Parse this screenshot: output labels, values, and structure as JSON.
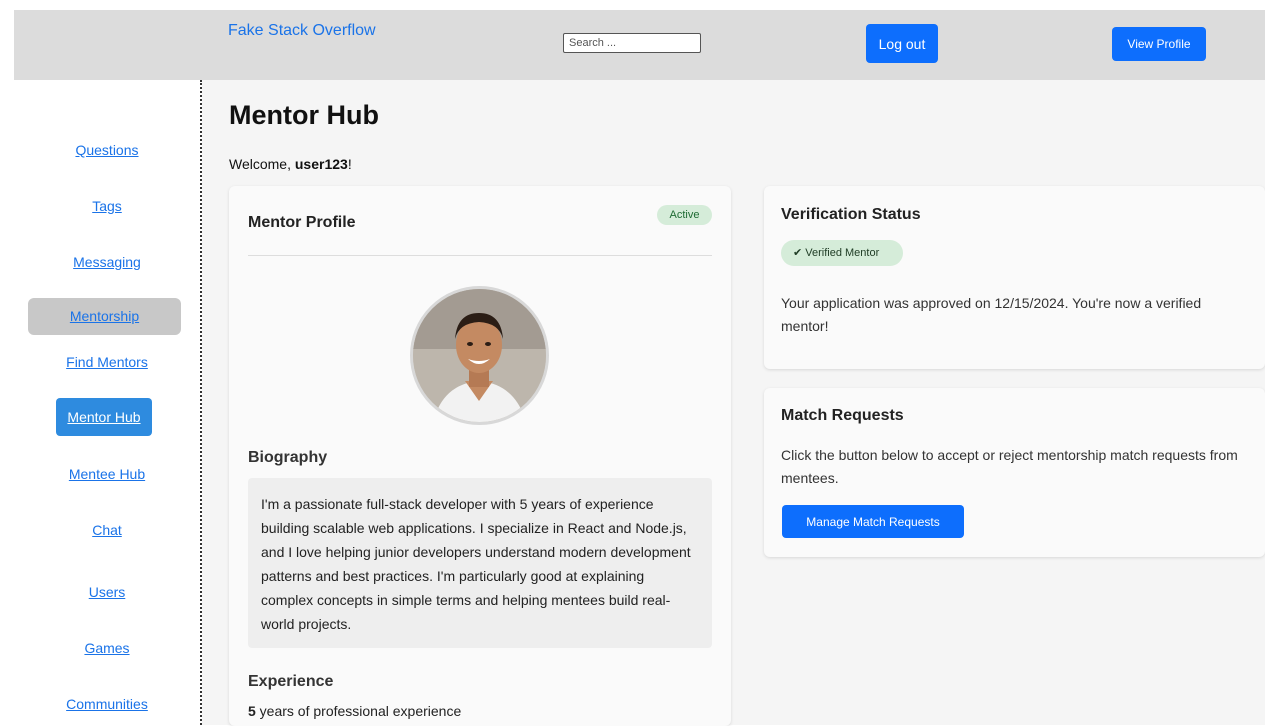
{
  "header": {
    "brand": "Fake Stack Overflow",
    "search_placeholder": "Search ...",
    "logout_label": "Log out",
    "view_profile_label": "View Profile"
  },
  "sidebar": {
    "items": [
      {
        "label": "Questions"
      },
      {
        "label": "Tags"
      },
      {
        "label": "Messaging"
      },
      {
        "label": "Mentorship"
      },
      {
        "label": "Find Mentors"
      },
      {
        "label": "Mentor Hub"
      },
      {
        "label": "Mentee Hub"
      },
      {
        "label": "Chat"
      },
      {
        "label": "Users"
      },
      {
        "label": "Games"
      },
      {
        "label": "Communities"
      }
    ]
  },
  "main": {
    "title": "Mentor Hub",
    "welcome_prefix": "Welcome, ",
    "username": "user123",
    "welcome_suffix": "!"
  },
  "profile": {
    "title": "Mentor Profile",
    "status": "Active",
    "biography_heading": "Biography",
    "biography": "I'm a passionate full-stack developer with 5 years of experience building scalable web applications. I specialize in React and Node.js, and I love helping junior developers understand modern development patterns and best practices. I'm particularly good at explaining complex concepts in simple terms and helping mentees build real-world projects.",
    "experience_heading": "Experience",
    "experience_years": "5",
    "experience_suffix": " years of professional experience"
  },
  "verification": {
    "title": "Verification Status",
    "badge": "✔ Verified Mentor",
    "text": "Your application was approved on 12/15/2024. You're now a verified mentor!"
  },
  "match_requests": {
    "title": "Match Requests",
    "text": "Click the button below to accept or reject mentorship match requests from mentees.",
    "button_label": "Manage Match Requests"
  },
  "colors": {
    "accent": "#0d6efd",
    "link": "#1a73e8",
    "badge_bg": "#d5ecd9"
  }
}
